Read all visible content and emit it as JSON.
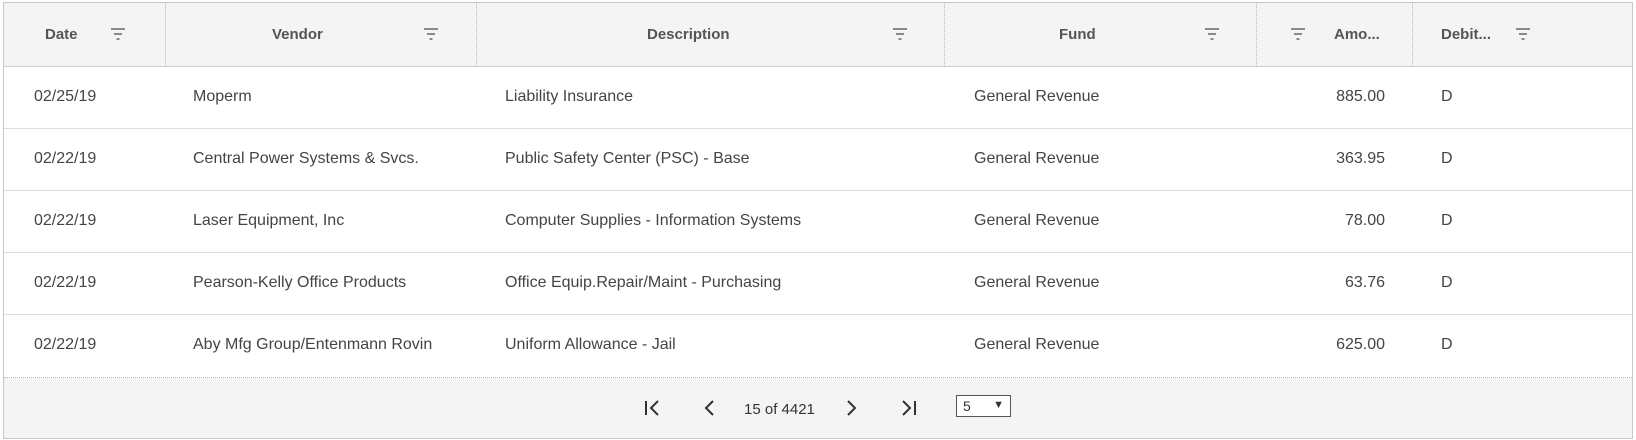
{
  "columns": [
    {
      "key": "date",
      "label": "Date"
    },
    {
      "key": "vendor",
      "label": "Vendor"
    },
    {
      "key": "description",
      "label": "Description"
    },
    {
      "key": "fund",
      "label": "Fund"
    },
    {
      "key": "amount",
      "label": "Amo..."
    },
    {
      "key": "debit",
      "label": "Debit..."
    }
  ],
  "rows": [
    {
      "date": "02/25/19",
      "vendor": "Moperm",
      "description": "Liability Insurance",
      "fund": "General Revenue",
      "amount": "885.00",
      "debit": "D"
    },
    {
      "date": "02/22/19",
      "vendor": "Central Power Systems & Svcs.",
      "description": "Public Safety Center (PSC) - Base",
      "fund": "General Revenue",
      "amount": "363.95",
      "debit": "D"
    },
    {
      "date": "02/22/19",
      "vendor": "Laser Equipment, Inc",
      "description": "Computer Supplies - Information Systems",
      "fund": "General Revenue",
      "amount": "78.00",
      "debit": "D"
    },
    {
      "date": "02/22/19",
      "vendor": "Pearson-Kelly Office Products",
      "description": "Office Equip.Repair/Maint - Purchasing",
      "fund": "General Revenue",
      "amount": "63.76",
      "debit": "D"
    },
    {
      "date": "02/22/19",
      "vendor": "Aby Mfg Group/Entenmann Rovin",
      "description": "Uniform Allowance - Jail",
      "fund": "General Revenue",
      "amount": "625.00",
      "debit": "D"
    }
  ],
  "pager": {
    "info": "15 of 4421",
    "page_size": "5",
    "icons": {
      "first": "first-page-icon",
      "prev": "chevron-left-icon",
      "next": "chevron-right-icon",
      "last": "last-page-icon",
      "filter": "filter-icon"
    }
  }
}
